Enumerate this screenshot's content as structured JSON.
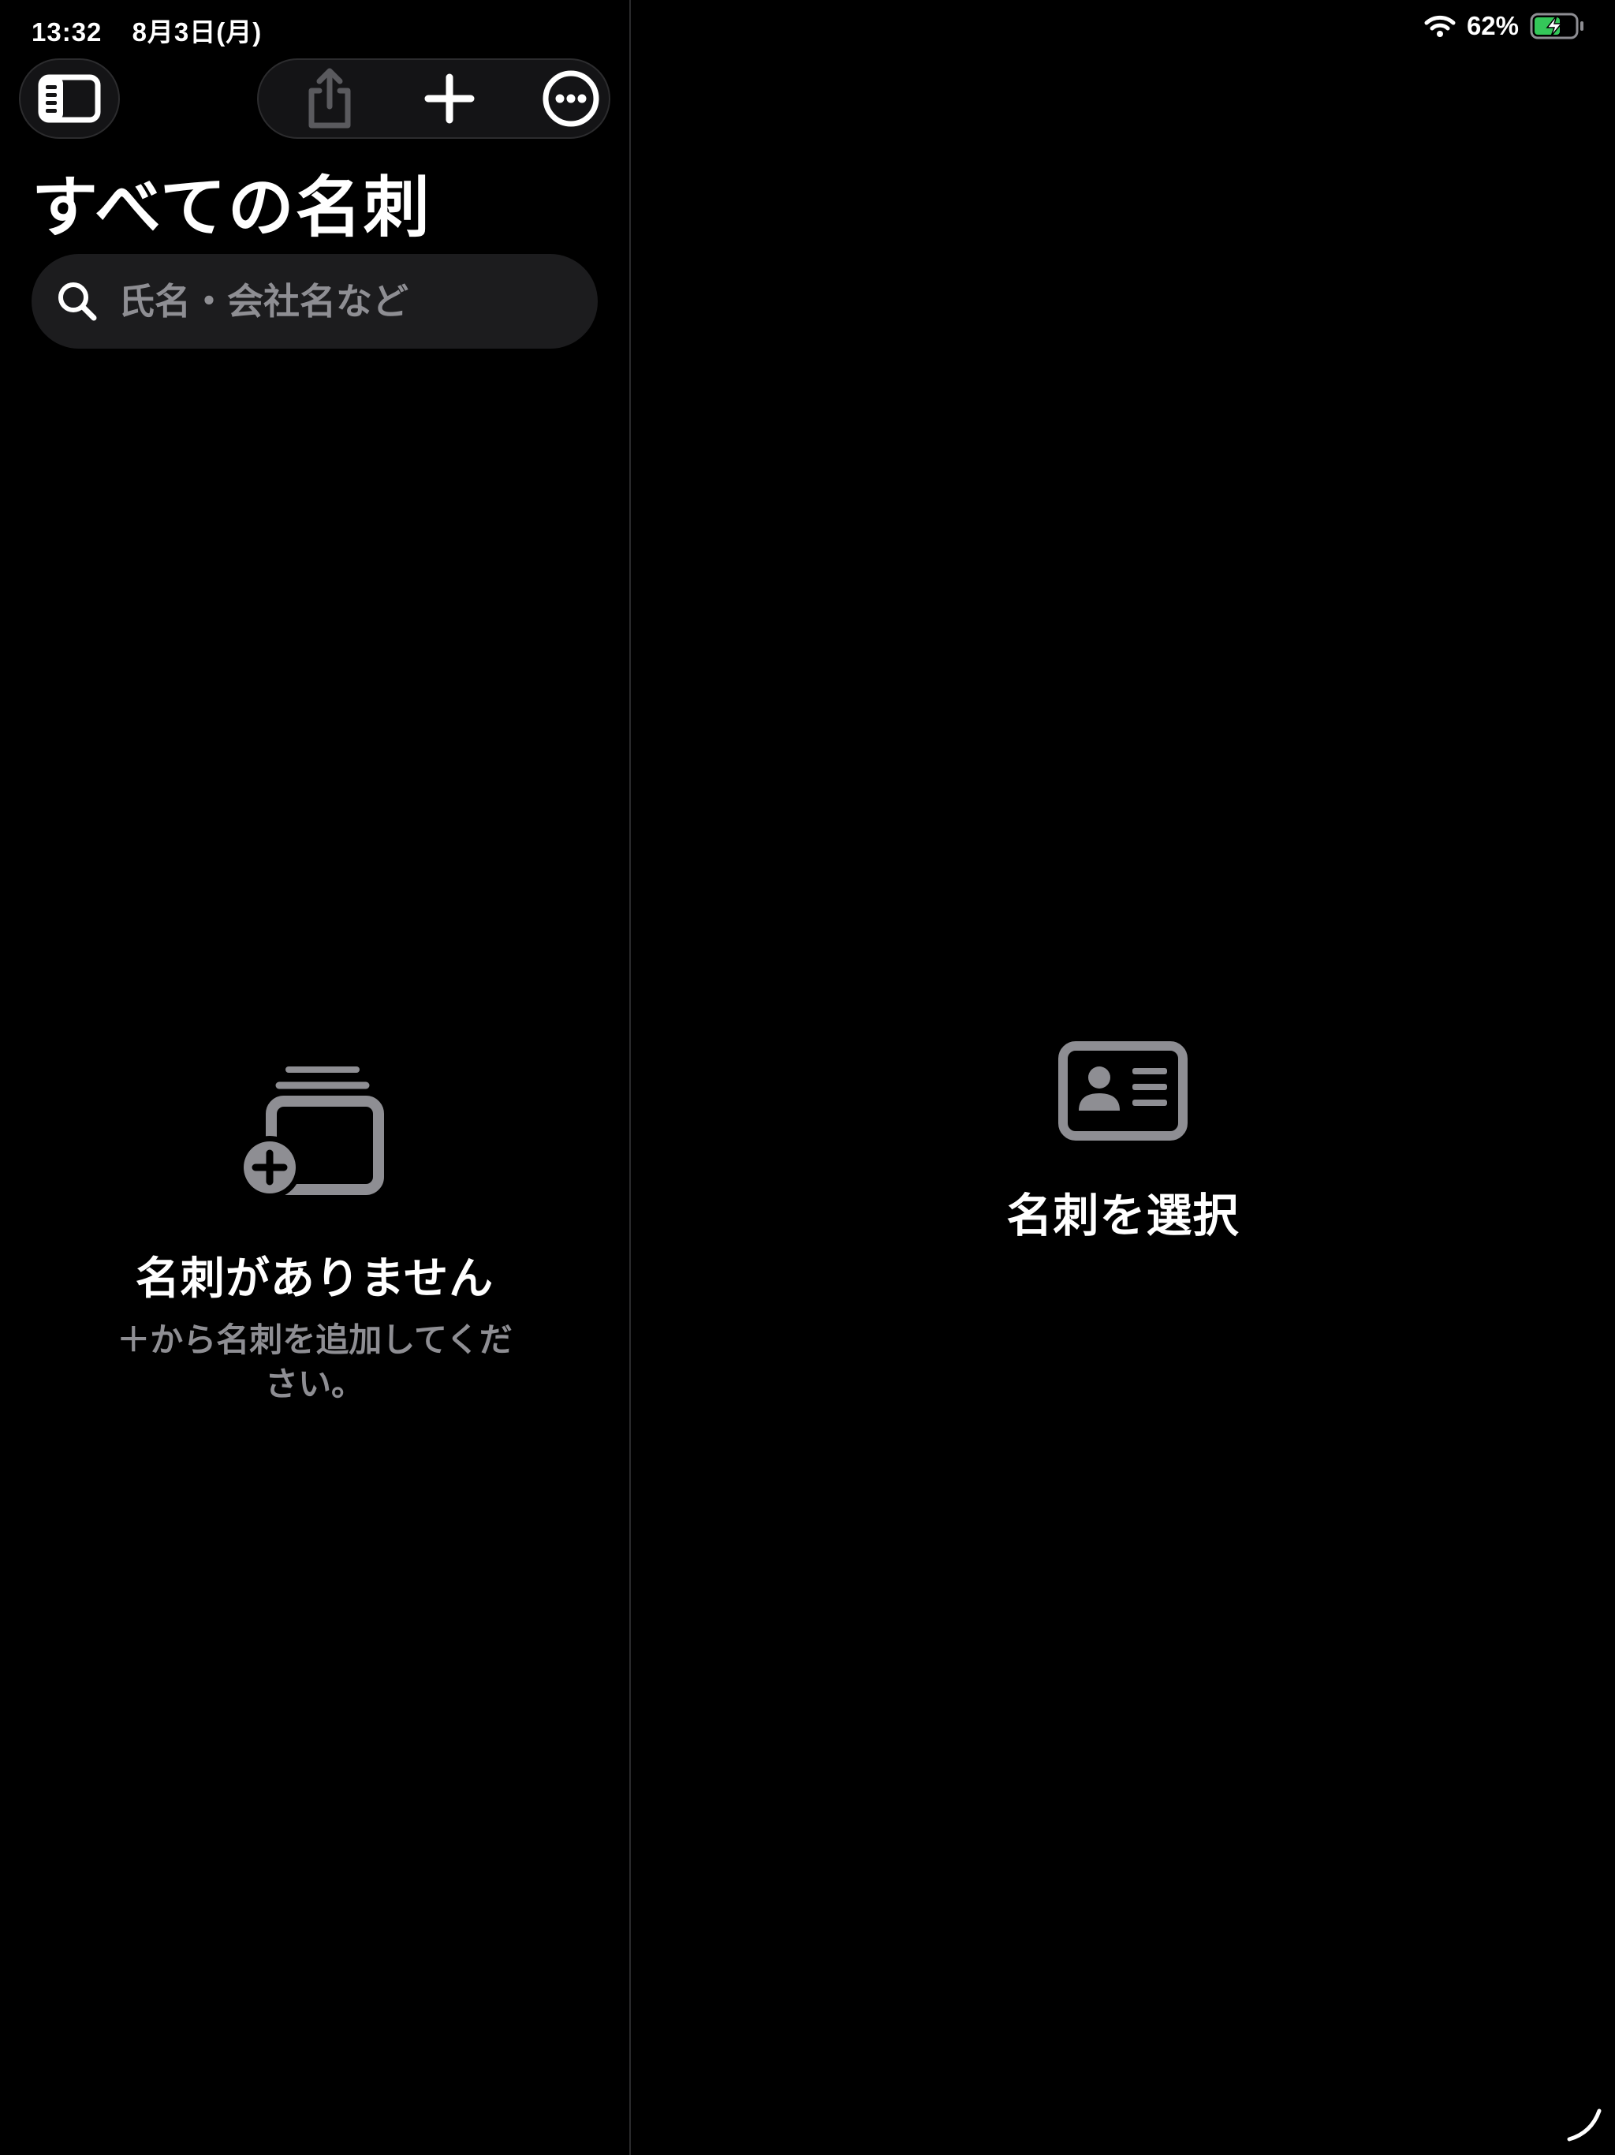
{
  "status_bar": {
    "time": "13:32",
    "date": "8月3日(月)",
    "battery": "62%",
    "battery_color": "#34c759"
  },
  "sidebar": {
    "title": "すべての名刺",
    "search": {
      "placeholder": "氏名・会社名など",
      "value": ""
    },
    "toolbar": {
      "toggle_icon": "sidebar-left-icon",
      "share_icon": "share-icon",
      "add_icon": "plus-icon",
      "more_icon": "ellipsis-circle-icon"
    },
    "empty_state": {
      "icon": "card-stack-add-icon",
      "title": "名刺がありません",
      "subtitle": "＋から名刺を追加してください。"
    }
  },
  "detail": {
    "empty_state": {
      "icon": "contact-card-icon",
      "title": "名刺を選択"
    }
  },
  "colors": {
    "background": "#000000",
    "secondary_text": "#8e8e93",
    "icon_gray": "#8e8e93",
    "field_background": "#1c1c1e"
  }
}
